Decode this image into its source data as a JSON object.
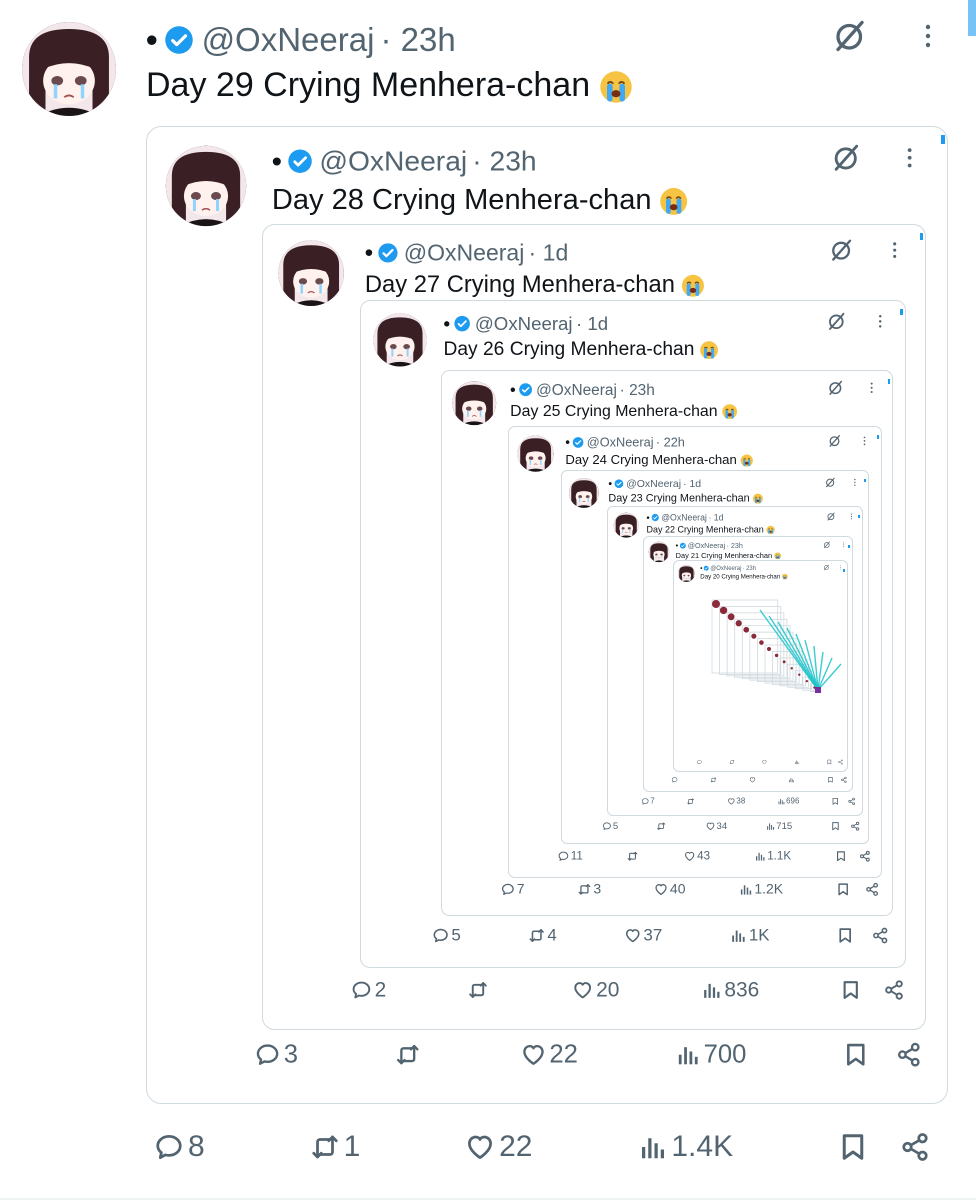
{
  "levels": [
    {
      "handle": "@OxNeeraj",
      "time": "23h",
      "text": "Day 29 Crying Menhera-chan",
      "replies": "8",
      "retweets": "1",
      "likes": "22",
      "views": "1.4K"
    },
    {
      "handle": "@OxNeeraj",
      "time": "23h",
      "text": "Day 28 Crying Menhera-chan",
      "replies": "3",
      "retweets": "",
      "likes": "22",
      "views": "700"
    },
    {
      "handle": "@OxNeeraj",
      "time": "1d",
      "text": "Day 27 Crying Menhera-chan",
      "replies": "2",
      "retweets": "",
      "likes": "20",
      "views": "836"
    },
    {
      "handle": "@OxNeeraj",
      "time": "1d",
      "text": "Day 26 Crying Menhera-chan",
      "replies": "5",
      "retweets": "4",
      "likes": "37",
      "views": "1K"
    },
    {
      "handle": "@OxNeeraj",
      "time": "23h",
      "text": "Day 25 Crying Menhera-chan",
      "replies": "7",
      "retweets": "3",
      "likes": "40",
      "views": "1.2K"
    },
    {
      "handle": "@OxNeeraj",
      "time": "22h",
      "text": "Day 24 Crying Menhera-chan",
      "replies": "11",
      "retweets": "",
      "likes": "43",
      "views": "1.1K"
    },
    {
      "handle": "@OxNeeraj",
      "time": "1d",
      "text": "Day 23 Crying Menhera-chan",
      "replies": "5",
      "retweets": "",
      "likes": "34",
      "views": "715"
    },
    {
      "handle": "@OxNeeraj",
      "time": "1d",
      "text": "Day 22 Crying Menhera-chan",
      "replies": "7",
      "retweets": "",
      "likes": "38",
      "views": "696"
    },
    {
      "handle": "@OxNeeraj",
      "time": "23h",
      "text": "Day 21 Crying Menhera-chan",
      "replies": "",
      "retweets": "",
      "likes": "",
      "views": ""
    },
    {
      "handle": "@OxNeeraj",
      "time": "23h",
      "text": "Day 20 Crying Menhera-chan",
      "replies": "",
      "retweets": "",
      "likes": "",
      "views": ""
    }
  ],
  "colors": {
    "accent": "#1d9bf0",
    "muted": "#536471",
    "text": "#0f1419",
    "border": "#cfd9de",
    "swirl": "#19c3c9"
  },
  "icons": [
    "verified-badge-icon",
    "grok-icon",
    "more-icon",
    "reply-icon",
    "retweet-icon",
    "like-icon",
    "views-icon",
    "bookmark-icon",
    "share-icon",
    "crying-emoji-icon"
  ]
}
